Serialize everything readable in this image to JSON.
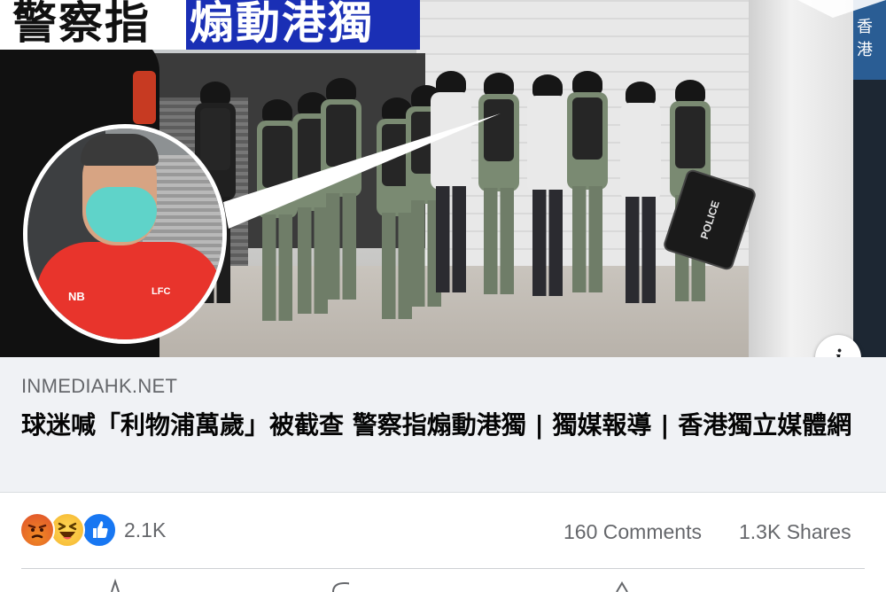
{
  "image": {
    "headline_part1": "警察指",
    "headline_part2": "煽動港獨",
    "right_sign": "香港",
    "shield_text": "POLICE",
    "shirt_logo": "NB",
    "shirt_crest": "LFC"
  },
  "card": {
    "domain": "INMEDIAHK.NET",
    "title": "球迷喊「利物浦萬歲」被截查 警察指煽動港獨 | 獨媒報導 | 香港獨立媒體網"
  },
  "info_button": {
    "label": "i"
  },
  "reactions": {
    "icons": [
      "angry-reaction-icon",
      "haha-reaction-icon",
      "like-reaction-icon"
    ],
    "count": "2.1K"
  },
  "engagement": {
    "comments": "160 Comments",
    "shares": "1.3K Shares"
  },
  "colors": {
    "headline_blue": "#1a2fb5",
    "like_blue": "#1877f2",
    "card_bg": "#f0f2f5",
    "meta_text": "#65676b"
  }
}
